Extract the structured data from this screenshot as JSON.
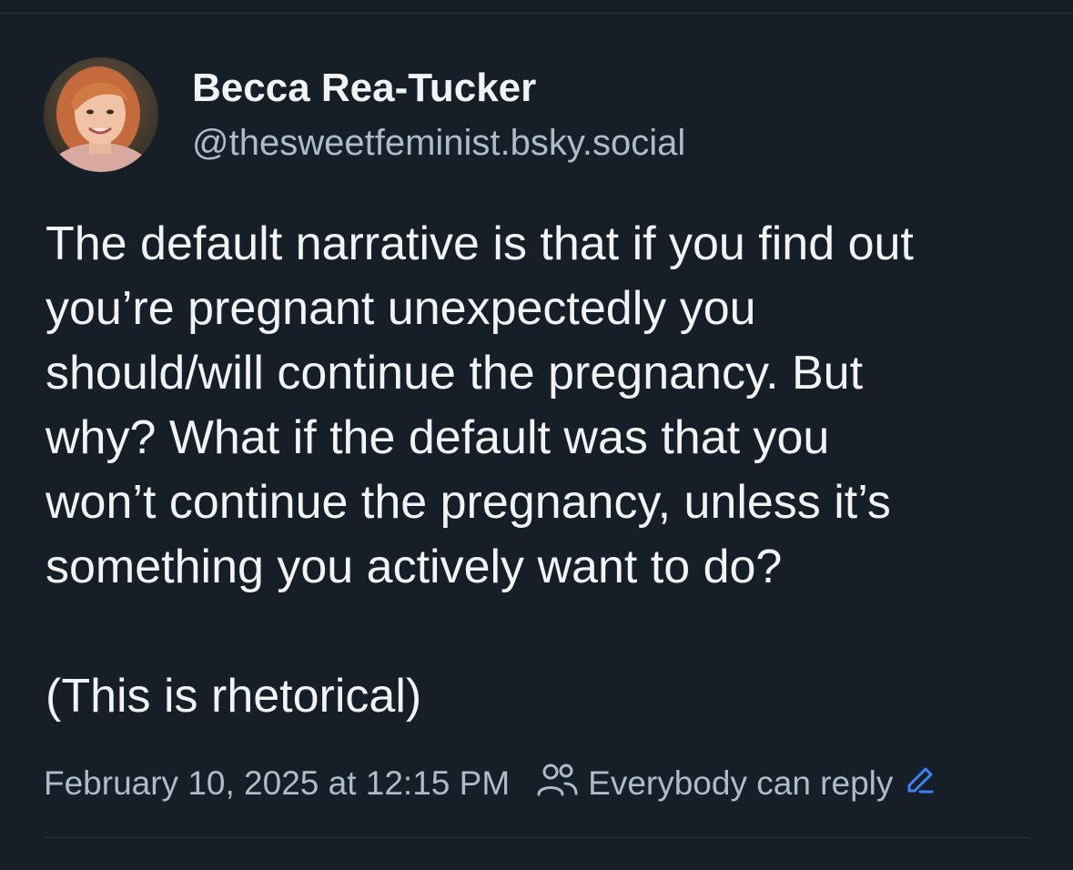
{
  "post": {
    "author": {
      "display_name": "Becca Rea-Tucker",
      "handle": "@thesweetfeminist.bsky.social",
      "avatar_icon": "user-avatar"
    },
    "text_paragraph_1": "The default narrative is that if you find out\nyou’re pregnant unexpectedly you\nshould/will continue the pregnancy. But\nwhy? What if the default was that you\nwon’t continue the pregnancy, unless it’s\nsomething you actively want to do?",
    "text_paragraph_2": "(This is rhetorical)",
    "timestamp": "February 10, 2025 at 12:15 PM",
    "reply_setting": {
      "label": "Everybody can reply",
      "icon": "people-icon",
      "edit_icon": "pencil-icon"
    }
  },
  "colors": {
    "background": "#161e27",
    "text_primary": "#f1f3f5",
    "text_secondary": "#aebbc9",
    "accent": "#3b82f6",
    "divider": "#2a3441"
  }
}
